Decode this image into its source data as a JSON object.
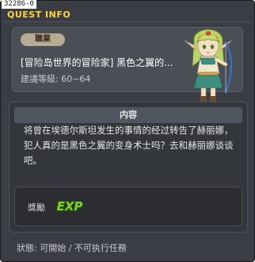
{
  "window": {
    "id_tag": "32286-0",
    "title": "QUEST INFO"
  },
  "quest": {
    "job_badge": "職業",
    "name": "[冒险岛世界的冒险家] 黑色之翼的...",
    "level": "建議等級: 60~64",
    "portrait_icon": "elf-archer-npc-icon"
  },
  "content": {
    "header": "内容",
    "description": "将曾在埃德尔斯坦发生的事情的经过转告了赫丽娜，犯人真的是黑色之翼的变身术士吗？去和赫丽娜谈谈吧。"
  },
  "reward": {
    "label": "獎勵",
    "icon": "exp-icon",
    "icon_text": "EXP"
  },
  "status": {
    "text": "狀態: 可開始 / 不可执行任務"
  },
  "colors": {
    "title": "#ffd43a",
    "window_bg": "#3a3d43",
    "badge_bg": "#b8ab94",
    "exp_green": "#7ed321"
  }
}
